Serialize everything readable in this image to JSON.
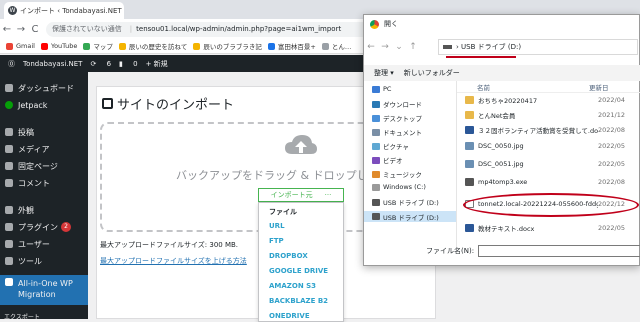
{
  "browser": {
    "tab_title": "インポート ‹ Tondabayasi.NET — W…",
    "nav": {
      "back": "←",
      "forward": "→",
      "reload": "C"
    },
    "address": {
      "warning": "保護されていない通信",
      "url": "tensou01.local/wp-admin/admin.php?page=ai1wm_import"
    },
    "bookmarks": [
      "Gmail",
      "YouTube",
      "マップ",
      "辰いの歴史を訪ねて",
      "辰いのブラブラき記",
      "富田林百景+",
      "とん…"
    ]
  },
  "adminbar": {
    "site": "Tondabayasi.NET",
    "updates": "6",
    "comments": "0",
    "new": "+ 新規"
  },
  "sidebar": {
    "items": [
      {
        "label": "ダッシュボード"
      },
      {
        "label": "Jetpack"
      },
      {
        "label": "投稿"
      },
      {
        "label": "メディア"
      },
      {
        "label": "固定ページ"
      },
      {
        "label": "コメント"
      },
      {
        "label": "外観"
      },
      {
        "label": "プラグイン",
        "badge": "2"
      },
      {
        "label": "ユーザー"
      },
      {
        "label": "ツール"
      },
      {
        "label": "All-in-One WP Migration"
      }
    ],
    "footer": "エクスポート"
  },
  "main": {
    "title": "サイトのインポート",
    "drop_text": "バックアップをドラッグ & ドロップしてイ",
    "import_button": "インポート元",
    "import_more": "···",
    "options": [
      "ファイル",
      "URL",
      "FTP",
      "DROPBOX",
      "GOOGLE DRIVE",
      "AMAZON S3",
      "BACKBLAZE B2",
      "ONEDRIVE"
    ],
    "max_size": "最大アップロードファイルサイズ: 300 MB.",
    "increase_link": "最大アップロードファイルサイズを上げる方法"
  },
  "dialog": {
    "title": "開く",
    "path": "USB ドライブ (D:)",
    "toolbar": {
      "organize": "整理 ▾",
      "new_folder": "新しいフォルダー"
    },
    "tree": [
      {
        "label": "PC",
        "type": "pc"
      },
      {
        "label": "ダウンロード",
        "type": "dl"
      },
      {
        "label": "デスクトップ",
        "type": "desk"
      },
      {
        "label": "ドキュメント",
        "type": "doc"
      },
      {
        "label": "ピクチャ",
        "type": "pic"
      },
      {
        "label": "ビデオ",
        "type": "vid"
      },
      {
        "label": "ミュージック",
        "type": "mus"
      },
      {
        "label": "Windows (C:)",
        "type": "drv"
      },
      {
        "label": "USB ドライブ (D:)",
        "type": "usb"
      },
      {
        "label": "USB ドライブ (D:)",
        "type": "usb",
        "selected": true
      }
    ],
    "columns": {
      "name": "名前",
      "date": "更新日"
    },
    "files": [
      {
        "name": "おちちゃ20220417",
        "date": "2022/04",
        "type": "folder"
      },
      {
        "name": "とんNet会員",
        "date": "2021/12",
        "type": "folder"
      },
      {
        "name": "３２固ボランティア活動賞を受賞して.docx",
        "date": "2022/08",
        "type": "docx"
      },
      {
        "name": "DSC_0050.jpg",
        "date": "2022/05",
        "type": "jpg"
      },
      {
        "name": "DSC_0051.jpg",
        "date": "2022/05",
        "type": "jpg"
      },
      {
        "name": "mp4tomp3.exe",
        "date": "2022/08",
        "type": "exe"
      },
      {
        "name": "tonnet2.local-20221224-055600-fddgoo…",
        "date": "2022/12",
        "type": "wpress"
      },
      {
        "name": "教材テキスト.docx",
        "date": "2022/05",
        "type": "docx"
      }
    ],
    "filename_label": "ファイル名(N):"
  },
  "colors": {
    "wp_dark": "#1d2327",
    "wp_blue": "#2271b1",
    "aio_green": "#46b450",
    "highlight_red": "#c0001a"
  }
}
